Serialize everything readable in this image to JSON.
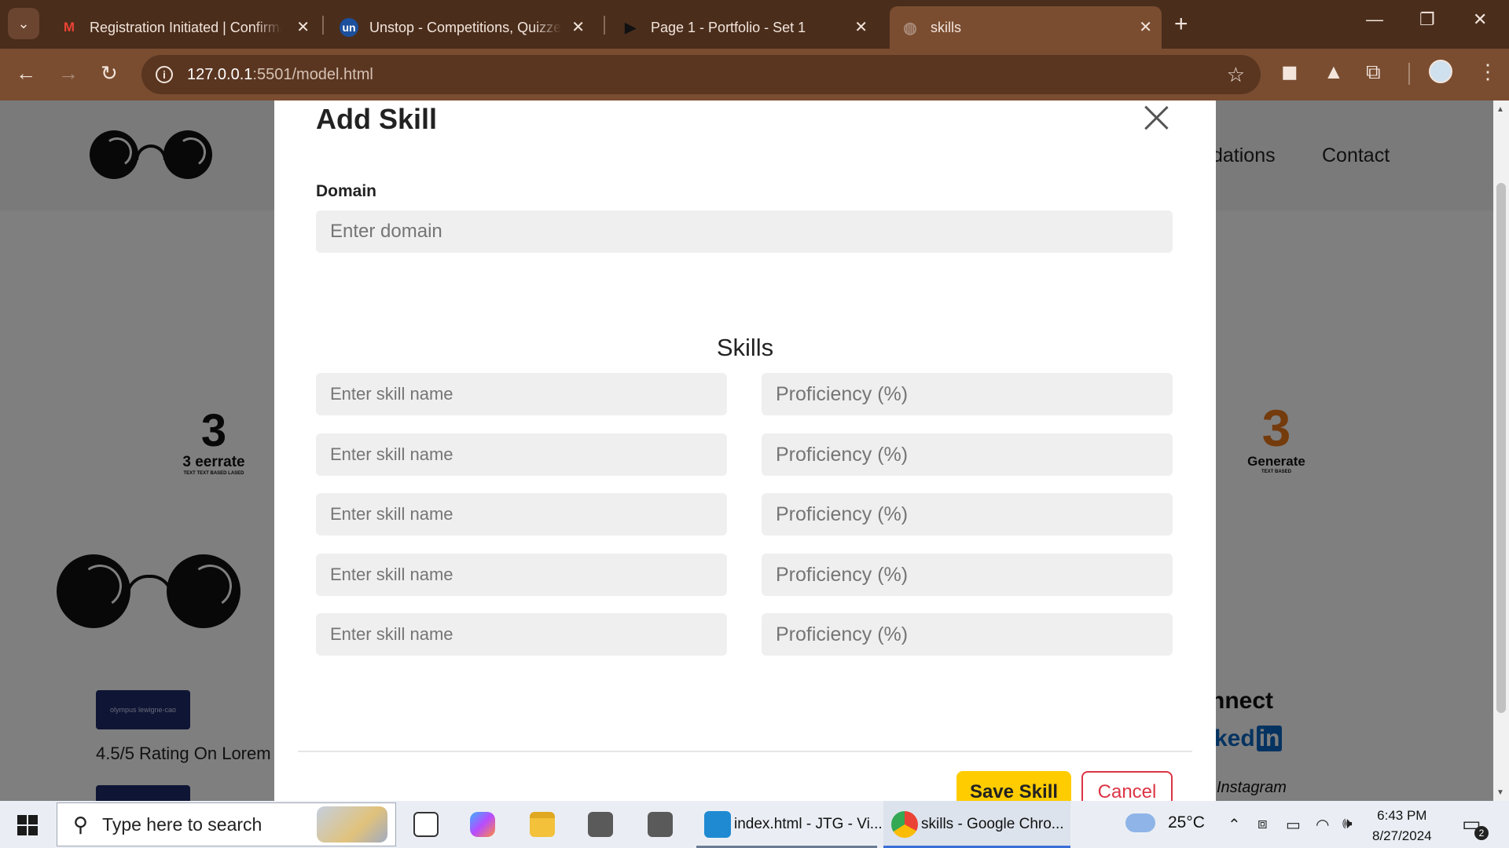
{
  "browser": {
    "tabs": [
      {
        "title": "Registration Initiated | Confirma",
        "icon": "gmail-icon"
      },
      {
        "title": "Unstop - Competitions, Quizzes",
        "icon": "unstop-icon",
        "icon_text": "un"
      },
      {
        "title": "Page 1 - Portfolio - Set 1",
        "icon": "play-icon"
      },
      {
        "title": "skills",
        "icon": "globe-icon",
        "active": true
      }
    ],
    "url_host": "127.0.0.1",
    "url_rest": ":5501/model.html"
  },
  "page": {
    "nav": [
      "dations",
      "Contact"
    ],
    "logo_left_text": "3 eerrate",
    "logo_left_sub": "TEXT TEXT BASED LASED",
    "logo_right_text": "Generate",
    "logo_right_sub": "TEXT BASED",
    "badge_text": "olympus lewigne-cao",
    "rating": "4.5/5 Rating On Lorem",
    "connect": "nnect",
    "linkedin": "ked",
    "instagram": "Instagram"
  },
  "modal": {
    "title": "Add Skill",
    "domain_label": "Domain",
    "domain_placeholder": "Enter domain",
    "skills_heading": "Skills",
    "skill_name_placeholder": "Enter skill name",
    "proficiency_placeholder": "Proficiency (%)",
    "skill_rows": 5,
    "save_label": "Save Skill",
    "cancel_label": "Cancel"
  },
  "taskbar": {
    "search_placeholder": "Type here to search",
    "apps": [
      {
        "label": "index.html - JTG - Vi...",
        "icon": "vscode-icon"
      },
      {
        "label": "skills - Google Chro...",
        "icon": "chrome-icon",
        "active": true
      }
    ],
    "temperature": "25°C",
    "time": "6:43 PM",
    "date": "8/27/2024",
    "notification_count": "2"
  },
  "colors": {
    "chrome_frame": "#4a2d1b",
    "chrome_toolbar": "#7a4d31",
    "save_button": "#ffcc00",
    "cancel_button": "#dc3545"
  }
}
